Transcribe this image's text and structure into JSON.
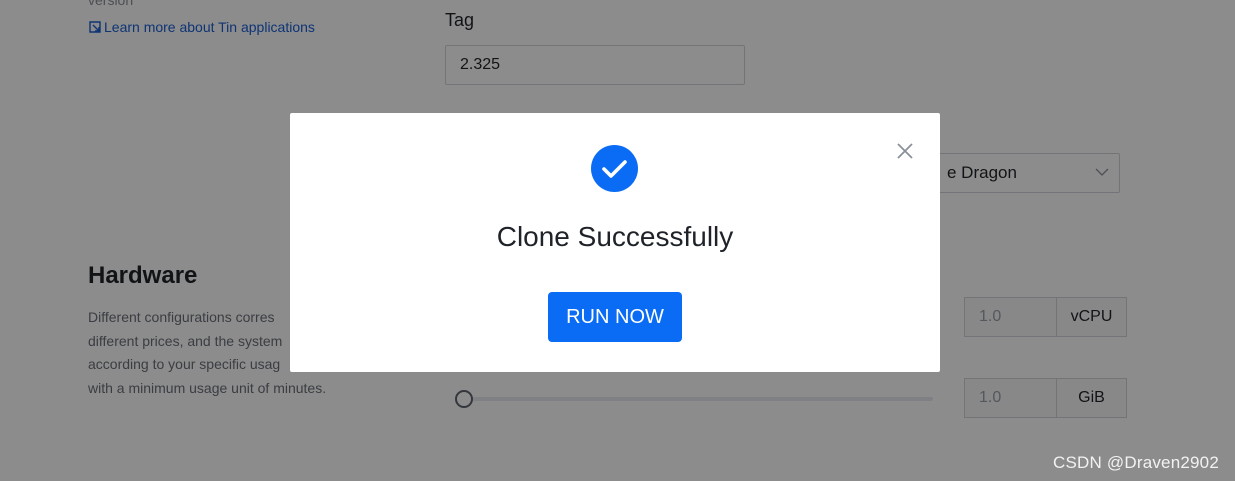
{
  "background": {
    "version_label": "version",
    "learn_link": "Learn more about Tin applications",
    "tag": {
      "label": "Tag",
      "value": "2.325"
    },
    "select": {
      "value": "e Dragon"
    },
    "hardware": {
      "title": "Hardware",
      "description_lines": [
        "Different configurations corres",
        "different prices, and the system",
        "according to your specific usag",
        "with a minimum usage unit of minutes."
      ],
      "cpu": {
        "value": "1.0",
        "unit": "vCPU"
      },
      "memory": {
        "value": "1.0",
        "unit": "GiB"
      },
      "memory_slider_fraction": 0.0
    }
  },
  "modal": {
    "title": "Clone Successfully",
    "button_label": "RUN NOW",
    "success_icon": "check-circle-icon",
    "close_icon": "close-icon"
  },
  "colors": {
    "accent": "#0a6cf5",
    "overlay": "rgba(0,0,0,0.45)",
    "link": "#1a5fd6"
  },
  "watermark": "CSDN @Draven2902"
}
